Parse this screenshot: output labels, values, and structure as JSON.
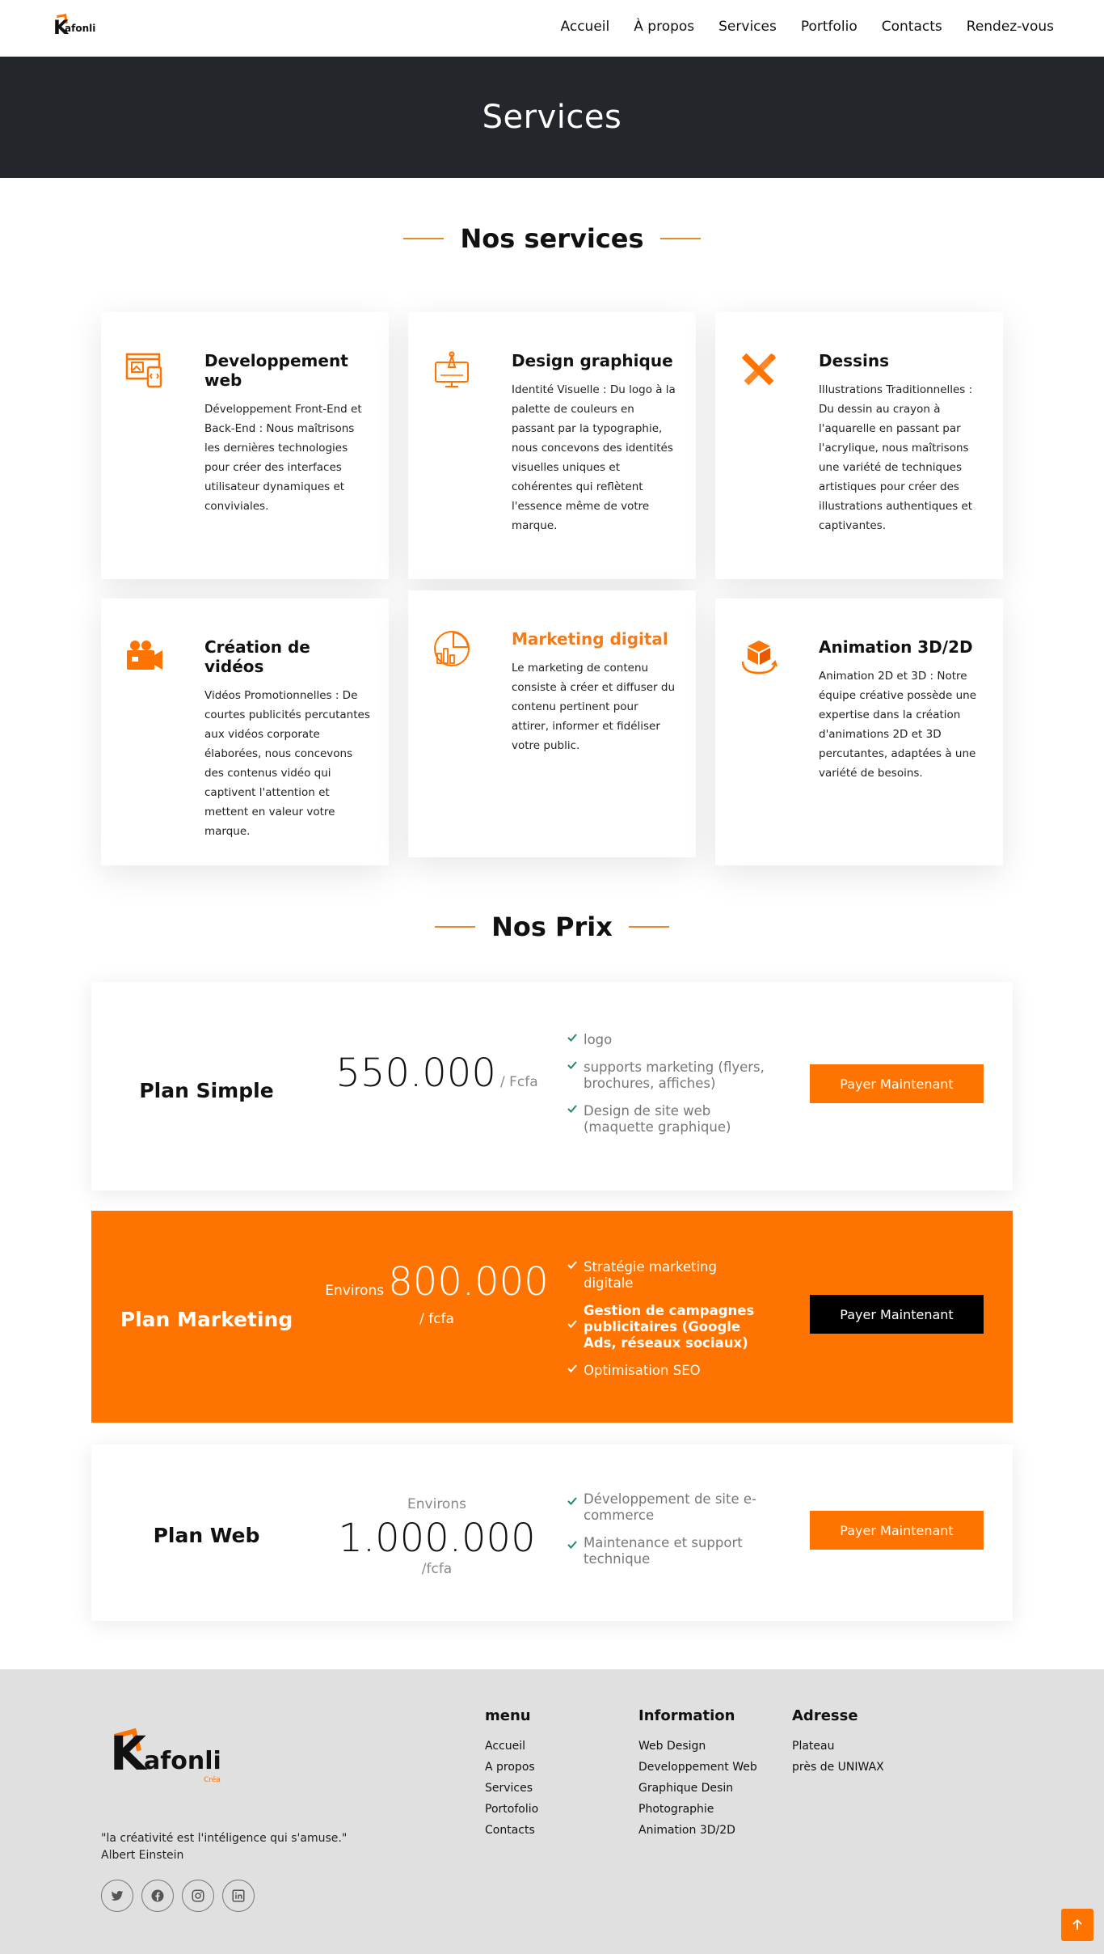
{
  "nav": {
    "logo_k": "K",
    "logo_rest": "afonli",
    "items": [
      "Accueil",
      "À propos",
      "Services",
      "Portfolio",
      "Contacts",
      "Rendez-vous"
    ]
  },
  "hero": {
    "title": "Services"
  },
  "services_section": {
    "title": "Nos services",
    "cards": [
      {
        "icon": "web-development-icon",
        "title": "Developpement web",
        "text": "Développement Front-End et Back-End : Nous maîtrisons les dernières technologies pour créer des interfaces utilisateur dynamiques et conviviales."
      },
      {
        "icon": "graphic-design-icon",
        "title": "Design graphique",
        "text": "Identité Visuelle : Du logo à la palette de couleurs en passant par la typographie, nous concevons des identités visuelles uniques et cohérentes qui reflètent l'essence même de votre marque."
      },
      {
        "icon": "drawing-icon",
        "title": "Dessins",
        "text": "Illustrations Traditionnelles : Du dessin au crayon à l'aquarelle en passant par l'acrylique, nous maîtrisons une variété de techniques artistiques pour créer des illustrations authentiques et captivantes."
      },
      {
        "icon": "video-camera-icon",
        "title": "Création de vidéos",
        "text": "Vidéos Promotionnelles : De courtes publicités percutantes aux vidéos corporate élaborées, nous concevons des contenus vidéo qui captivent l'attention et mettent en valeur votre marque."
      },
      {
        "icon": "pie-chart-icon",
        "title": "Marketing digital",
        "text": "Le marketing de contenu consiste à créer et diffuser du contenu pertinent pour attirer, informer et fidéliser votre public."
      },
      {
        "icon": "3d-cube-icon",
        "title": "Animation 3D/2D",
        "text": "Animation 2D et 3D : Notre équipe créative possède une expertise dans la création d'animations 2D et 3D percutantes, adaptées à une variété de besoins."
      }
    ]
  },
  "prices_section": {
    "title": "Nos Prix",
    "plans": [
      {
        "name": "Plan Simple",
        "prefix": "",
        "amount": "550.000",
        "unit": "/ Fcfa",
        "features": [
          "logo",
          "supports marketing (flyers, brochures, affiches)",
          "Design de site web (maquette graphique)"
        ],
        "button": "Payer Maintenant"
      },
      {
        "name": "Plan Marketing",
        "prefix": "Environs",
        "amount": "800.000",
        "unit": "/ fcfa",
        "features": [
          "Stratégie marketing digitale",
          "Gestion de campagnes publicitaires (Google Ads, réseaux sociaux)",
          "Optimisation SEO"
        ],
        "button": "Payer Maintenant"
      },
      {
        "name": "Plan Web",
        "prefix": "Environs",
        "amount": "1.000.000",
        "unit": "/fcfa",
        "features": [
          "Développement de site e-commerce",
          "Maintenance et support technique"
        ],
        "button": "Payer Maintenant"
      }
    ]
  },
  "footer": {
    "logo_k": "K",
    "logo_rest": "afonli",
    "logo_tag": "Créa",
    "quote": "\"la créativité est l'intéligence qui s'amuse.\"",
    "quote_author": "Albert Einstein",
    "socials": [
      "twitter-icon",
      "facebook-icon",
      "instagram-icon",
      "linkedin-icon"
    ],
    "menu": {
      "title": "menu",
      "items": [
        "Accueil",
        "A propos",
        "Services",
        "Portofolio",
        "Contacts"
      ]
    },
    "info": {
      "title": "Information",
      "items": [
        "Web Design",
        "Developpement Web",
        "Graphique Desin",
        "Photographie",
        "Animation 3D/2D"
      ]
    },
    "address": {
      "title": "Adresse",
      "items": [
        "Plateau",
        "près de UNIWAX"
      ]
    }
  },
  "colors": {
    "accent": "#ff7300",
    "hero_bg": "#23262b",
    "footer_bg": "#e0e0e0",
    "check": "#1e8a6e"
  }
}
